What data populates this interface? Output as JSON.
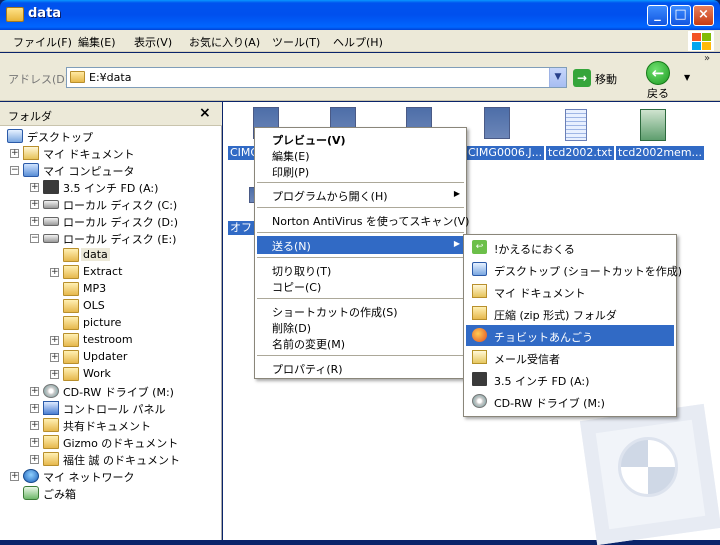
{
  "window": {
    "title": "data",
    "buttons": {
      "minimize": "_",
      "maximize": "□",
      "close": "×"
    }
  },
  "menubar": {
    "items": [
      "ファイル(F)",
      "編集(E)",
      "表示(V)",
      "お気に入り(A)",
      "ツール(T)",
      "ヘルプ(H)"
    ]
  },
  "address": {
    "label": "アドレス(D)",
    "value": "E:¥data",
    "go_label": "移動",
    "back_label": "戻る"
  },
  "folders": {
    "title": "フォルダ",
    "tree": [
      {
        "label": "デスクトップ",
        "icon": "desktop-icon",
        "expander": ""
      },
      {
        "label": "マイ ドキュメント",
        "icon": "my-documents-icon",
        "expander": "+"
      },
      {
        "label": "マイ コンピュータ",
        "icon": "computer-icon",
        "expander": "−"
      },
      {
        "label": "3.5 インチ FD (A:)",
        "icon": "floppy-icon",
        "expander": "+"
      },
      {
        "label": "ローカル ディスク (C:)",
        "icon": "drive-icon",
        "expander": "+"
      },
      {
        "label": "ローカル ディスク (D:)",
        "icon": "drive-icon",
        "expander": "+"
      },
      {
        "label": "ローカル ディスク (E:)",
        "icon": "drive-icon",
        "expander": "−"
      },
      {
        "label": "data",
        "icon": "folder-icon",
        "expander": "",
        "selected": true
      },
      {
        "label": "Extract",
        "icon": "folder-icon",
        "expander": "+"
      },
      {
        "label": "MP3",
        "icon": "folder-icon",
        "expander": ""
      },
      {
        "label": "OLS",
        "icon": "folder-icon",
        "expander": ""
      },
      {
        "label": "picture",
        "icon": "folder-icon",
        "expander": ""
      },
      {
        "label": "testroom",
        "icon": "folder-icon",
        "expander": "+"
      },
      {
        "label": "Updater",
        "icon": "folder-icon",
        "expander": "+"
      },
      {
        "label": "Work",
        "icon": "folder-icon",
        "expander": "+"
      },
      {
        "label": "CD-RW ドライブ (M:)",
        "icon": "cd-icon",
        "expander": "+"
      },
      {
        "label": "コントロール パネル",
        "icon": "control-panel-icon",
        "expander": "+"
      },
      {
        "label": "共有ドキュメント",
        "icon": "folder-icon",
        "expander": "+"
      },
      {
        "label": "Gizmo のドキュメント",
        "icon": "folder-icon",
        "expander": "+"
      },
      {
        "label": "福住 誠 のドキュメント",
        "icon": "folder-icon",
        "expander": "+"
      },
      {
        "label": "マイ ネットワーク",
        "icon": "network-icon",
        "expander": "+"
      },
      {
        "label": "ごみ箱",
        "icon": "recycle-bin-icon",
        "expander": ""
      }
    ]
  },
  "files": {
    "items": [
      {
        "label": "CIMG",
        "type": "image"
      },
      {
        "label": "CIMG0006.J...",
        "type": "image"
      },
      {
        "label": "tcd2002.txt",
        "type": "text"
      },
      {
        "label": "tcd2002mem...",
        "type": "spreadsheet"
      },
      {
        "label": "オフ",
        "type": "image"
      }
    ]
  },
  "context_menu": {
    "items": [
      {
        "label": "プレビュー(V)",
        "bold": true
      },
      {
        "label": "編集(E)"
      },
      {
        "label": "印刷(P)"
      },
      {
        "label": "プログラムから開く(H)",
        "submenu": true
      },
      {
        "label": "Norton AntiVirus を使ってスキャン(V)"
      },
      {
        "label": "送る(N)",
        "submenu": true,
        "highlighted": true
      },
      {
        "label": "切り取り(T)"
      },
      {
        "label": "コピー(C)"
      },
      {
        "label": "ショートカットの作成(S)"
      },
      {
        "label": "削除(D)"
      },
      {
        "label": "名前の変更(M)"
      },
      {
        "label": "プロパティ(R)"
      }
    ]
  },
  "sendto_menu": {
    "items": [
      {
        "label": "!かえるにおくる",
        "icon": "kaeru-return-icon"
      },
      {
        "label": "デスクトップ (ショートカットを作成)",
        "icon": "desktop-icon"
      },
      {
        "label": "マイ ドキュメント",
        "icon": "my-documents-icon"
      },
      {
        "label": "圧縮 (zip 形式) フォルダ",
        "icon": "zip-folder-icon"
      },
      {
        "label": "チョビットあんごう",
        "icon": "chobit-angou-icon",
        "highlighted": true
      },
      {
        "label": "メール受信者",
        "icon": "mail-recipient-icon"
      },
      {
        "label": "3.5 インチ FD (A:)",
        "icon": "floppy-icon"
      },
      {
        "label": "CD-RW ドライブ (M:)",
        "icon": "cd-icon"
      }
    ]
  },
  "colors": {
    "title_bar": "#0054e3",
    "selection": "#316ac5",
    "chrome": "#ece9d8"
  }
}
